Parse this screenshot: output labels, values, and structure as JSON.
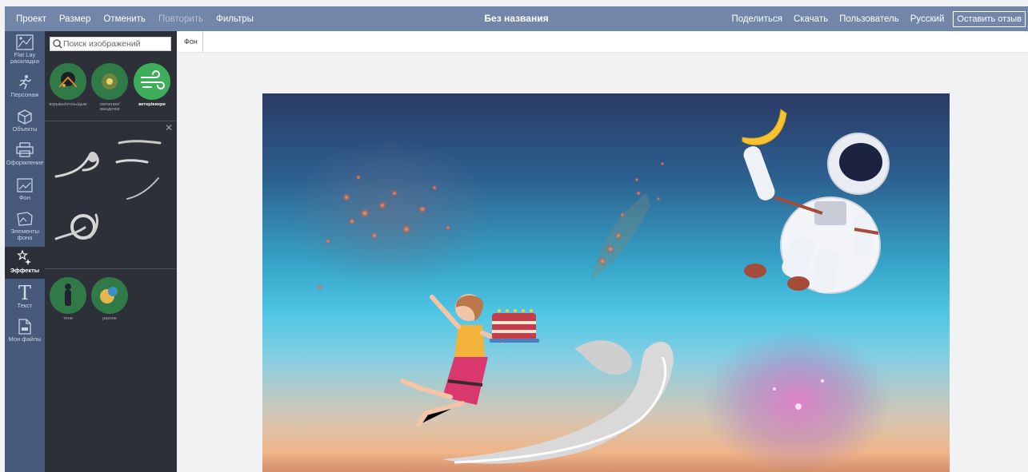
{
  "menu": {
    "project": "Проект",
    "size": "Размер",
    "undo": "Отменить",
    "redo": "Повторить",
    "filters": "Фильтры"
  },
  "document_title": "Без названия",
  "actions": {
    "share": "Поделиться",
    "download": "Скачать",
    "user": "Пользователь",
    "language": "Русский",
    "feedback": "Оставить отзыв"
  },
  "sidebar": {
    "items": [
      {
        "label": "Flat Lay раскладка",
        "icon": "flatlay-icon"
      },
      {
        "label": "Персонаж",
        "icon": "running-person-icon"
      },
      {
        "label": "Объекты",
        "icon": "box-icon"
      },
      {
        "label": "Оформление",
        "icon": "printer-icon"
      },
      {
        "label": "Фон",
        "icon": "picture-icon"
      },
      {
        "label": "Элементы фона",
        "icon": "scenery-icon"
      },
      {
        "label": "Эффекты",
        "icon": "sparkle-icon"
      },
      {
        "label": "Текст",
        "icon": "text-t-icon"
      },
      {
        "label": "Мои файлы",
        "icon": "my-file-icon"
      }
    ]
  },
  "panel": {
    "search_placeholder": "Поиск изображений",
    "categories": [
      {
        "label": "взрывы/огонь/дым"
      },
      {
        "label": "свечение/звездочки"
      },
      {
        "label": "ветер/вихри"
      }
    ],
    "categories2": [
      {
        "label": "тени"
      },
      {
        "label": "разное"
      }
    ]
  },
  "tabs": {
    "background": "Фон"
  },
  "colors": {
    "topbar": "#7286a9",
    "iconbar": "#475a7c",
    "panel": "#2d3038",
    "category_circle": "#2f7a46",
    "category_selected": "#3fae5a"
  }
}
